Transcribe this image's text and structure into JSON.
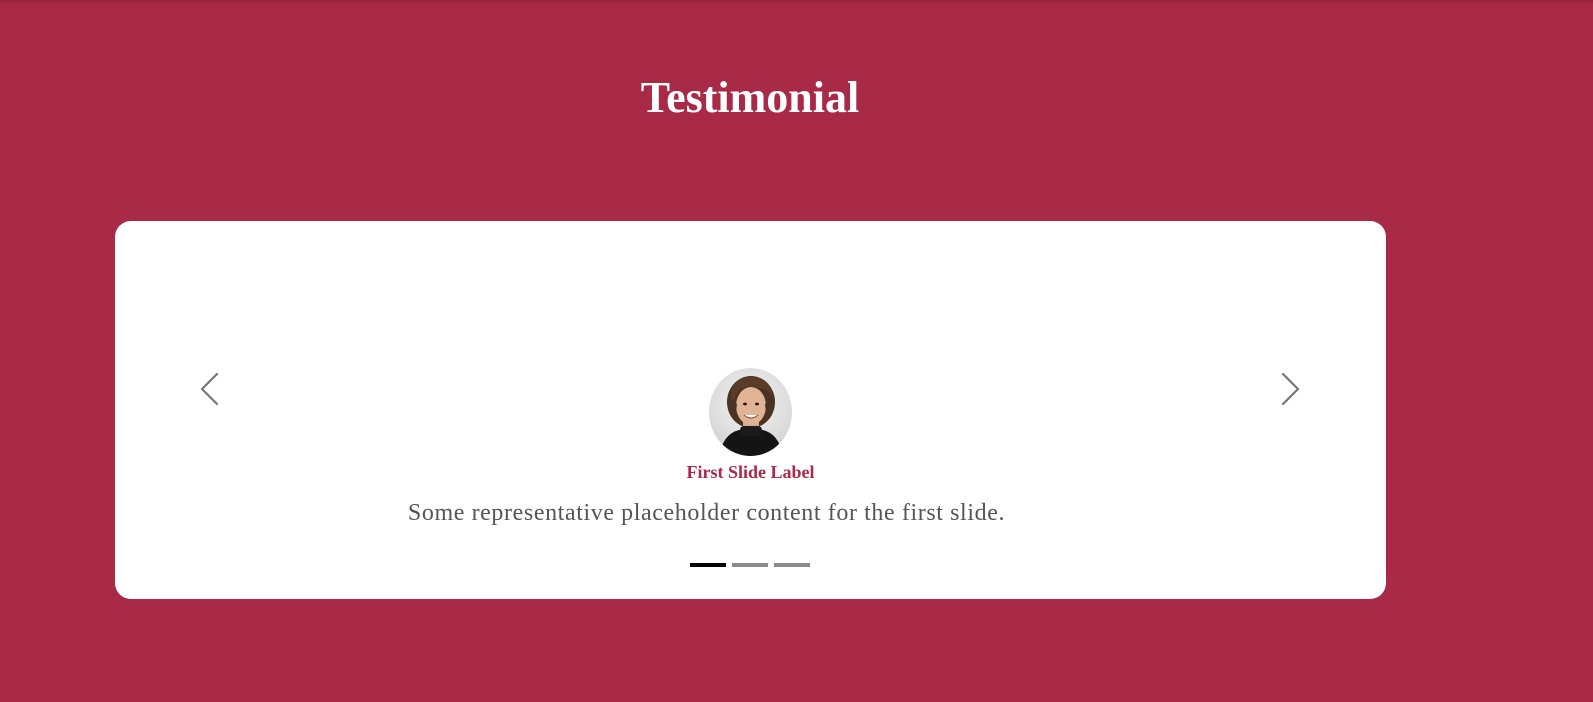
{
  "page": {
    "title": "Testimonial",
    "colors": {
      "background": "#a92a47",
      "card": "#ffffff",
      "accent": "#a92a47",
      "text": "#555555"
    }
  },
  "carousel": {
    "prev_icon": "chevron-left-icon",
    "next_icon": "chevron-right-icon",
    "active_index": 0,
    "slides": [
      {
        "label": "First Slide Label",
        "text": "Some representative placeholder content for the first slide."
      }
    ],
    "indicator_count": 3
  }
}
